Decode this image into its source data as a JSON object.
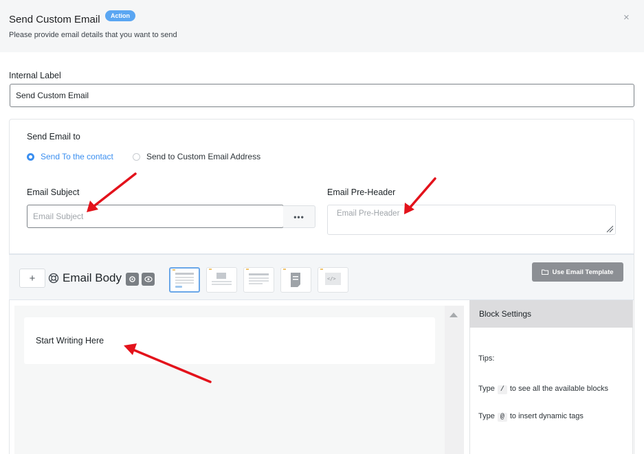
{
  "header": {
    "title": "Send Custom Email",
    "badge": "Action",
    "subtitle": "Please provide email details that you want to send",
    "close_label": "×"
  },
  "internal_label": {
    "label": "Internal Label",
    "value": "Send Custom Email"
  },
  "send_to": {
    "label": "Send Email to",
    "options": [
      {
        "label": "Send To the contact",
        "checked": true
      },
      {
        "label": "Send to Custom Email Address",
        "checked": false
      }
    ]
  },
  "subject": {
    "label": "Email Subject",
    "placeholder": "Email Subject",
    "dots_label": "•••"
  },
  "preheader": {
    "label": "Email Pre-Header",
    "placeholder": "Email Pre-Header"
  },
  "email_body": {
    "add_label": "+",
    "title": "Email Body",
    "template_button": "Use Email Template",
    "editor_text": "Start Writing Here"
  },
  "block_settings": {
    "title": "Block Settings",
    "tips_label": "Tips:",
    "tip1_prefix": "Type",
    "tip1_key": "/",
    "tip1_suffix": "to see all the available blocks",
    "tip2_prefix": "Type",
    "tip2_key": "@",
    "tip2_suffix": "to insert dynamic tags"
  },
  "colors": {
    "accent": "#3b8ff0",
    "arrow": "#e3121b",
    "badge": "#5aa6f2"
  },
  "icons": [
    "close-icon",
    "lifebuoy-icon",
    "settings-icon",
    "eye-icon",
    "folder-icon",
    "plus-icon",
    "scroll-up-icon"
  ]
}
